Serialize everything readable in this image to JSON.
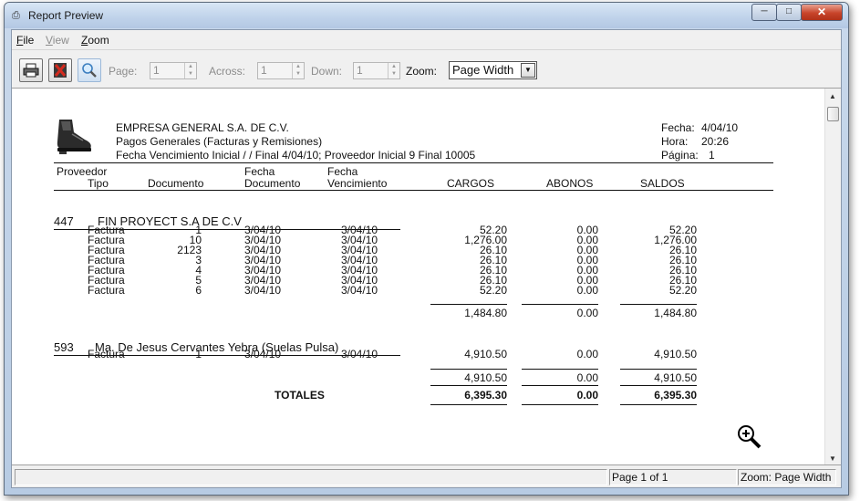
{
  "window": {
    "title": "Report Preview"
  },
  "menu": [
    {
      "label": "File",
      "underline": "F",
      "rest": "ile",
      "enabled": true
    },
    {
      "label": "View",
      "underline": "V",
      "rest": "iew",
      "enabled": false
    },
    {
      "label": "Zoom",
      "underline": "Z",
      "rest": "oom",
      "enabled": true
    }
  ],
  "toolbar": {
    "page_label": "Page:",
    "page_value": "1",
    "across_label": "Across:",
    "across_value": "1",
    "down_label": "Down:",
    "down_value": "1",
    "zoom_label": "Zoom:",
    "zoom_value": "Page Width"
  },
  "report": {
    "company": "EMPRESA GENERAL S.A. DE C.V.",
    "subtitle": "Pagos Generales (Facturas y Remisiones)",
    "criteria": "Fecha Vencimiento Inicial  / / Final  4/04/10;  Proveedor Inicial 9 Final 10005",
    "fecha_label": "Fecha:",
    "fecha_value": "4/04/10",
    "hora_label": "Hora:",
    "hora_value": "20:26",
    "pagina_label": "Página:",
    "pagina_value": "1",
    "columns": {
      "proveedor": "Proveedor",
      "tipo": "Tipo",
      "documento": "Documento",
      "fecha_doc_1": "Fecha",
      "fecha_doc_2": "Documento",
      "fecha_venc_1": "Fecha",
      "fecha_venc_2": "Vencimiento",
      "cargos": "CARGOS",
      "abonos": "ABONOS",
      "saldos": "SALDOS"
    },
    "groups": [
      {
        "code": "447",
        "name": "FIN PROYECT S.A DE C.V",
        "rows": [
          [
            "Factura",
            "1",
            "3/04/10",
            "3/04/10",
            "52.20",
            "0.00",
            "52.20"
          ],
          [
            "Factura",
            "10",
            "3/04/10",
            "3/04/10",
            "1,276.00",
            "0.00",
            "1,276.00"
          ],
          [
            "Factura",
            "2123",
            "3/04/10",
            "3/04/10",
            "26.10",
            "0.00",
            "26.10"
          ],
          [
            "Factura",
            "3",
            "3/04/10",
            "3/04/10",
            "26.10",
            "0.00",
            "26.10"
          ],
          [
            "Factura",
            "4",
            "3/04/10",
            "3/04/10",
            "26.10",
            "0.00",
            "26.10"
          ],
          [
            "Factura",
            "5",
            "3/04/10",
            "3/04/10",
            "26.10",
            "0.00",
            "26.10"
          ],
          [
            "Factura",
            "6",
            "3/04/10",
            "3/04/10",
            "52.20",
            "0.00",
            "52.20"
          ]
        ],
        "subtotal": [
          "1,484.80",
          "0.00",
          "1,484.80"
        ]
      },
      {
        "code": "593",
        "name": "Ma. De Jesus Cervantes Yebra (Suelas Pulsa)",
        "rows": [
          [
            "Factura",
            "1",
            "3/04/10",
            "3/04/10",
            "4,910.50",
            "0.00",
            "4,910.50"
          ]
        ],
        "subtotal": [
          "4,910.50",
          "0.00",
          "4,910.50"
        ]
      }
    ],
    "totals_label": "TOTALES",
    "totals": [
      "6,395.30",
      "0.00",
      "6,395.30"
    ]
  },
  "status": {
    "page": "Page 1 of 1",
    "zoom": "Zoom: Page Width"
  }
}
